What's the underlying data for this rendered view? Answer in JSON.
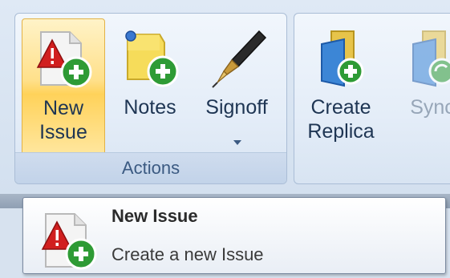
{
  "ribbon": {
    "groups": [
      {
        "label": "Actions",
        "buttons": [
          {
            "label_line1": "New",
            "label_line2": "Issue",
            "icon": "new-issue-icon",
            "selected": true
          },
          {
            "label_line1": "Notes",
            "icon": "notes-icon"
          },
          {
            "label_line1": "Signoff",
            "icon": "pen-icon",
            "has_dropdown": true
          }
        ]
      },
      {
        "label": "",
        "buttons": [
          {
            "label_line1": "Create",
            "label_line2": "Replica",
            "icon": "create-replica-icon"
          },
          {
            "label_line1": "Sync",
            "icon": "sync-replica-icon",
            "disabled": true
          }
        ]
      }
    ]
  },
  "tooltip": {
    "title": "New Issue",
    "description": "Create a new Issue",
    "icon": "new-issue-icon"
  },
  "colors": {
    "ribbon_bg": "#d7e2ef",
    "selected_bg": "#ffe08a",
    "group_label_text": "#3b5a82",
    "green_plus": "#2e9b35",
    "red_alert": "#d11f1f"
  }
}
